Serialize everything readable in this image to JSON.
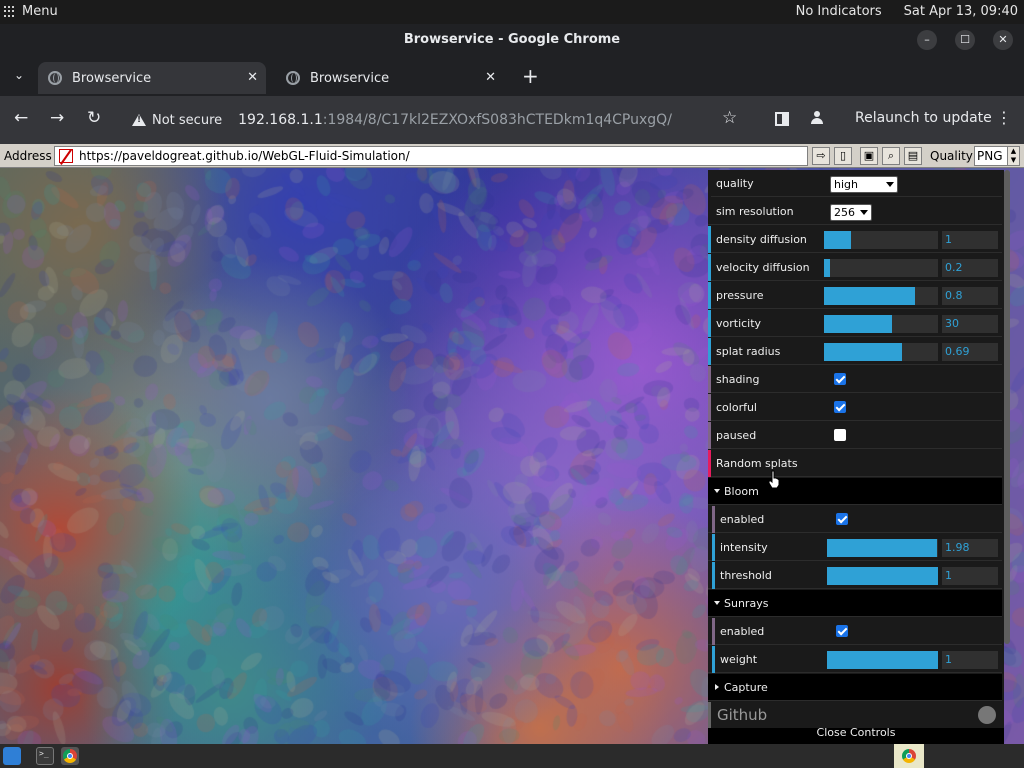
{
  "system_bar": {
    "menu_label": "Menu",
    "indicators": "No Indicators",
    "clock": "Sat Apr 13, 09:40"
  },
  "window": {
    "title": "Browservice - Google Chrome",
    "minimize": "–",
    "maximize": "☐",
    "close": "✕"
  },
  "tabs": [
    {
      "title": "Browservice",
      "close": "✕"
    },
    {
      "title": "Browservice",
      "close": "✕"
    }
  ],
  "tabstrip": {
    "new_tab": "+",
    "tab_search": "⌄"
  },
  "toolbar": {
    "back": "←",
    "forward": "→",
    "reload": "↻",
    "security_text": "Not secure",
    "url_host": "192.168.1.1",
    "url_path": ":1984/8/C17kl2EZXOxfS083hCTEDkm1q4CPuxgQ/",
    "star": "☆",
    "relaunch": "Relaunch to update",
    "menu": "⋮"
  },
  "remote_addressbar": {
    "label": "Address",
    "url": "https://paveldogreat.github.io/WebGL-Fluid-Simulation/",
    "quality_label": "Quality",
    "quality_value": "PNG",
    "buttons": {
      "go": "⇨",
      "bookmark": "▯",
      "save": "▣",
      "find": "⌕",
      "clipboard": "▤"
    }
  },
  "controls": {
    "quality": {
      "label": "quality",
      "value": "high"
    },
    "sim_resolution": {
      "label": "sim resolution",
      "value": "256"
    },
    "density_diffusion": {
      "label": "density diffusion",
      "value": "1",
      "fraction": 0.24
    },
    "velocity_diffusion": {
      "label": "velocity diffusion",
      "value": "0.2",
      "fraction": 0.05
    },
    "pressure": {
      "label": "pressure",
      "value": "0.8",
      "fraction": 0.8
    },
    "vorticity": {
      "label": "vorticity",
      "value": "30",
      "fraction": 0.6
    },
    "splat_radius": {
      "label": "splat radius",
      "value": "0.69",
      "fraction": 0.68
    },
    "shading": {
      "label": "shading",
      "checked": true
    },
    "colorful": {
      "label": "colorful",
      "checked": true
    },
    "paused": {
      "label": "paused",
      "checked": false
    },
    "random_splats": {
      "label": "Random splats"
    },
    "bloom": {
      "label": "Bloom",
      "enabled": {
        "label": "enabled",
        "checked": true
      },
      "intensity": {
        "label": "intensity",
        "value": "1.98",
        "fraction": 0.99
      },
      "threshold": {
        "label": "threshold",
        "value": "1",
        "fraction": 1.0
      }
    },
    "sunrays": {
      "label": "Sunrays",
      "enabled": {
        "label": "enabled",
        "checked": true
      },
      "weight": {
        "label": "weight",
        "value": "1",
        "fraction": 1.0
      }
    },
    "capture": {
      "label": "Capture"
    },
    "github": {
      "label": "Github"
    },
    "close_controls": "Close Controls"
  },
  "colors": {
    "slider_fill": "#2fa1d6",
    "number_bar": "#2fa1d6",
    "boolean_bar": "#806787",
    "function_bar": "#e61d5f",
    "chrome_bg": "#202124",
    "toolbar_bg": "#35363a"
  }
}
